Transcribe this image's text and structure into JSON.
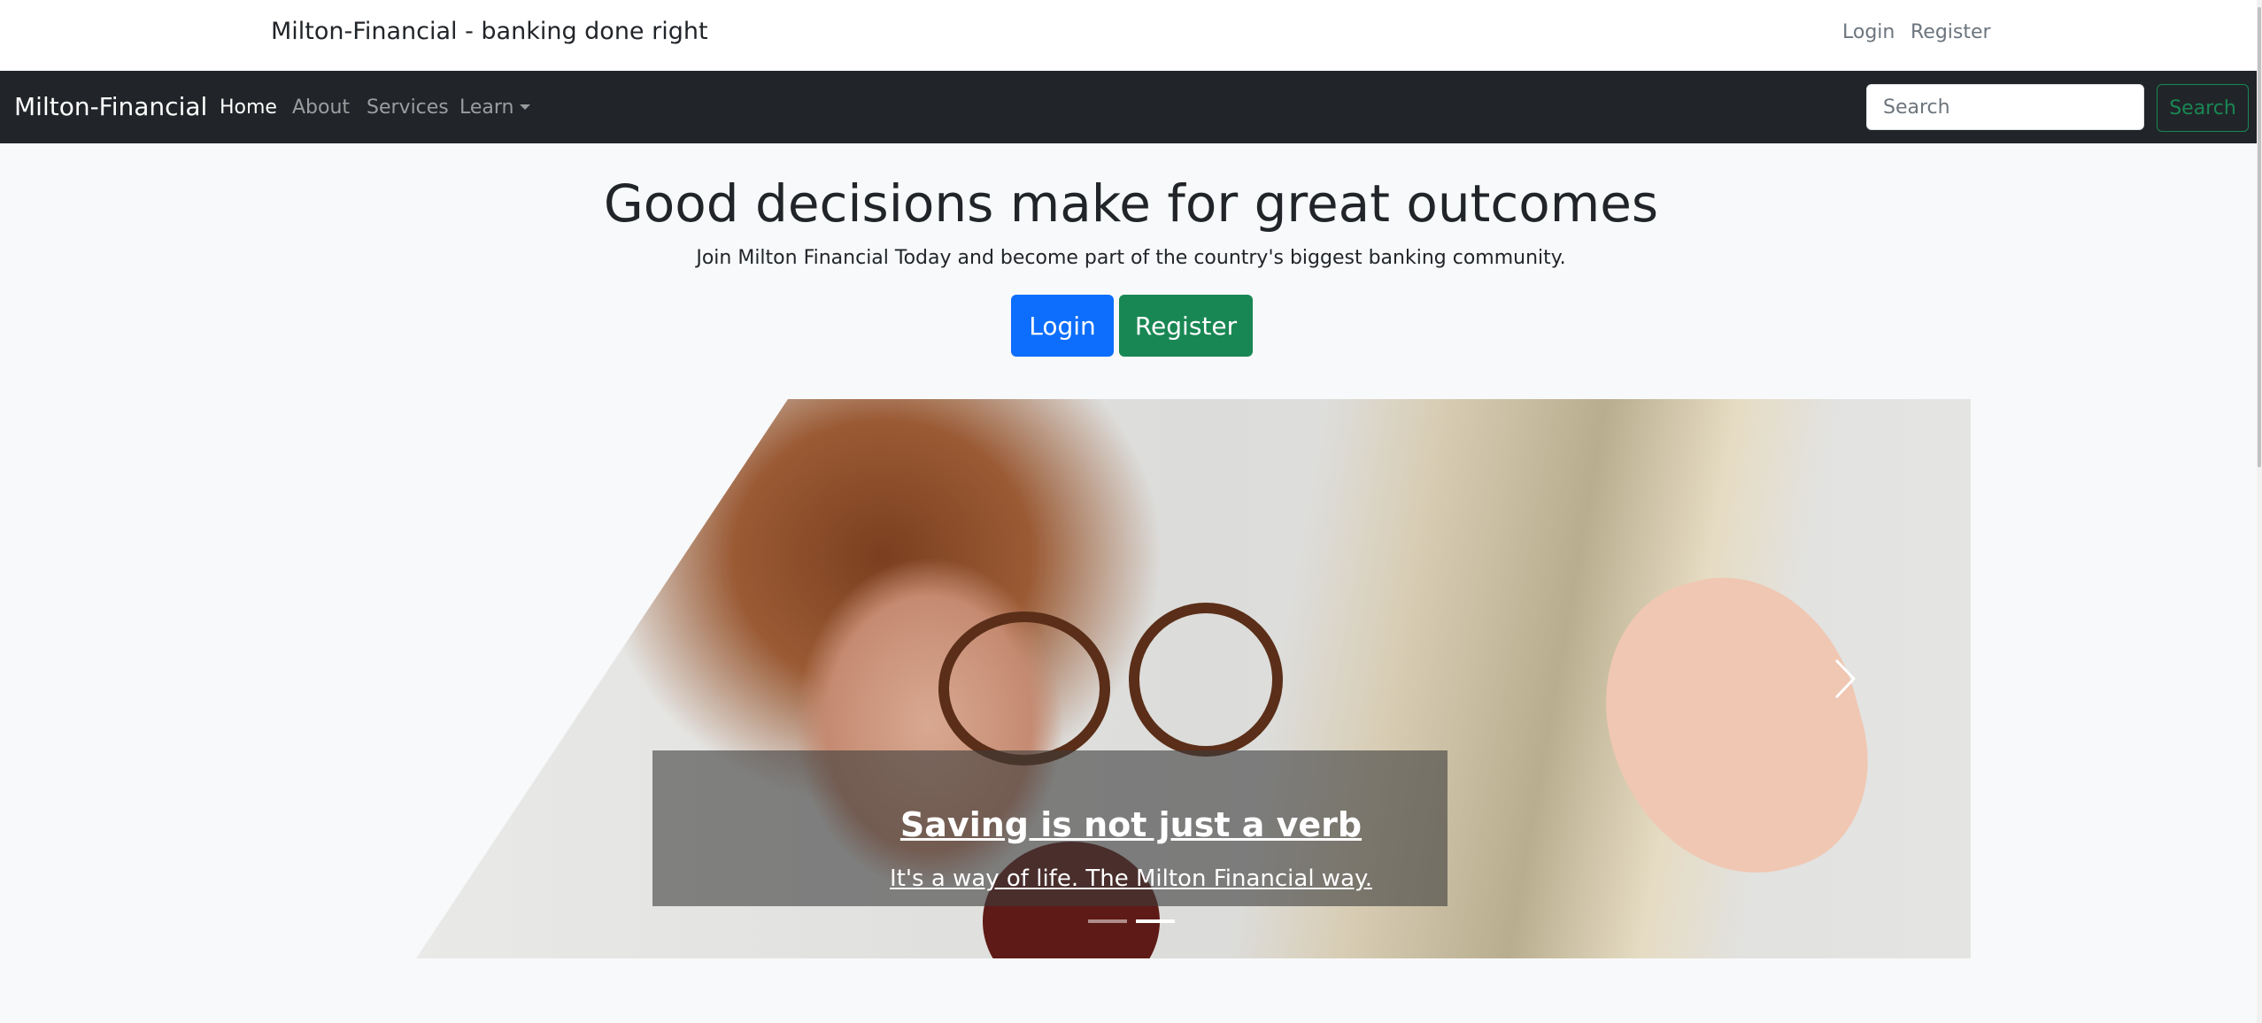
{
  "topbar": {
    "tagline": "Milton-Financial - banking done right",
    "login": "Login",
    "register": "Register"
  },
  "navbar": {
    "brand": "Milton-Financial",
    "items": [
      {
        "label": "Home",
        "active": true
      },
      {
        "label": "About"
      },
      {
        "label": "Services"
      },
      {
        "label": "Learn",
        "dropdown": true
      }
    ],
    "search_placeholder": "Search",
    "search_button": "Search"
  },
  "hero": {
    "title": "Good decisions make for great outcomes",
    "lead": "Join Milton Financial Today and become part of the country's biggest banking community.",
    "login_button": "Login",
    "register_button": "Register"
  },
  "carousel": {
    "caption_title": "Saving is not just a verb",
    "caption_text": "It's a way of life. The Milton Financial way.",
    "slide_count": 2,
    "active_slide": 2
  },
  "colors": {
    "navbar": "#212529",
    "primary": "#0d6efd",
    "success": "#198754",
    "background": "#f8f9fa"
  }
}
